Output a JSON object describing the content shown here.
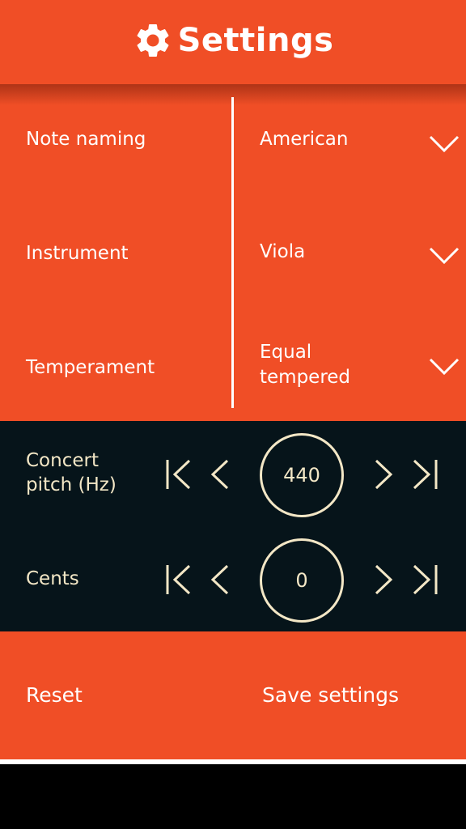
{
  "header": {
    "title": "Settings",
    "icon": "gear-icon"
  },
  "settings": [
    {
      "label": "Note naming",
      "value": "American"
    },
    {
      "label": "Instrument",
      "value": "Viola"
    },
    {
      "label": "Temperament",
      "value_line1": "Equal",
      "value_line2": "tempered"
    }
  ],
  "concert_pitch": {
    "label_line1": "Concert",
    "label_line2": "pitch (Hz)",
    "value": "440"
  },
  "cents": {
    "label": "Cents",
    "value": "0"
  },
  "footer": {
    "reset_label": "Reset",
    "save_label": "Save settings"
  },
  "colors": {
    "accent": "#f04e26",
    "dark_panel": "#06141a",
    "cream": "#f3e7c6"
  }
}
